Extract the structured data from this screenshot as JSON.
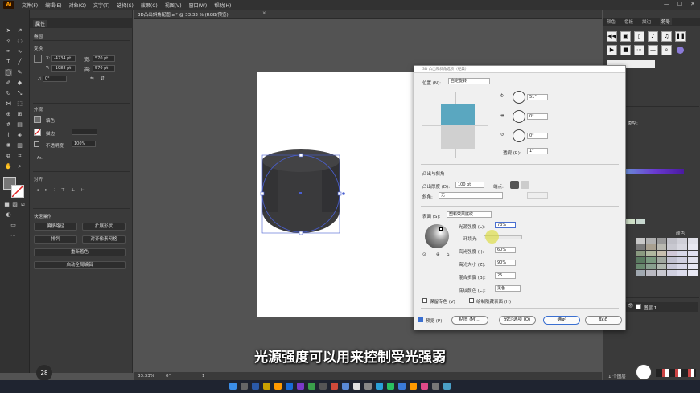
{
  "menubar": {
    "logo": "Ai",
    "items": [
      "文件(F)",
      "编辑(E)",
      "对象(O)",
      "文字(T)",
      "选择(S)",
      "效果(C)",
      "视图(V)",
      "窗口(W)",
      "帮助(H)"
    ]
  },
  "document_tab": {
    "title": "3D凸出斜角配图.ai* @ 33.33 % (RGB/预览)"
  },
  "properties_panel": {
    "tab": "属性",
    "section_shape": "椭圆",
    "section_transform": "变换",
    "x_label": "X:",
    "x_value": "-4734 pt",
    "y_label": "Y:",
    "y_value": "-1988 pt",
    "w_label": "宽:",
    "w_value": "570 pt",
    "h_label": "高:",
    "h_value": "570 pt",
    "rotate_value": "0°",
    "section_appearance": "外观",
    "fill_label": "填色",
    "stroke_label": "描边",
    "opacity_label": "不透明度",
    "opacity_value": "100%",
    "fx_label": "fx.",
    "section_align": "对齐",
    "section_quick": "快速操作",
    "buttons": [
      "偏移路径",
      "扩展形状",
      "排列",
      "对齐像素网格",
      "重新着色",
      "启动全局编辑"
    ]
  },
  "right_panel": {
    "tabs": [
      "颜色",
      "色板",
      "描边",
      "符号"
    ],
    "color_type_label": "类型:",
    "swatches_label": "颜色",
    "layer_name": "图层 1",
    "layer_count": "1 个图层"
  },
  "dialog": {
    "title": "3D 凸出和斜角选项（经典）",
    "position_label": "位置 (N):",
    "position_value": "自定旋转",
    "rot_x": "51°",
    "rot_y": "0°",
    "rot_z": "0°",
    "perspective_label": "透视 (R):",
    "perspective_value": "1°",
    "extrude_section": "凸出与斜角",
    "depth_label": "凸出厚度 (D):",
    "depth_value": "100 pt",
    "cap_label": "端点:",
    "bevel_label": "斜角:",
    "bevel_value": "无",
    "surface_label": "表面 (S):",
    "surface_value": "塑料效果底纹",
    "light_intensity_label": "光源强度 (L):",
    "light_intensity_value": "73%",
    "ambient_label": "环境光",
    "highlight_intensity_label": "高光强度 (I):",
    "highlight_intensity_value": "60%",
    "highlight_size_label": "高光大小 (Z):",
    "highlight_size_value": "90%",
    "blend_steps_label": "混合步骤 (B):",
    "blend_steps_value": "25",
    "shading_color_label": "底纹颜色 (C):",
    "shading_color_value": "黑色",
    "preserve_spot_label": "保留专色 (V)",
    "draw_hidden_label": "绘制隐藏表面 (H)",
    "preview_label": "预览 (P)",
    "map_button": "贴图 (M)...",
    "fewer_options_button": "较少选项 (O)",
    "ok_button": "确定",
    "cancel_button": "取消"
  },
  "status_bar": {
    "zoom": "33.33%",
    "angle": "0°",
    "page": "1"
  },
  "subtitle": "光源强度可以用来控制受光强弱",
  "badge": "28",
  "colors": {
    "cube_top": "#5aa7c0",
    "cube_front": "#d0d0d0",
    "selection": "#4a5fd0",
    "cylinder": "#3a3a3c",
    "accent": "#ff9a00"
  }
}
